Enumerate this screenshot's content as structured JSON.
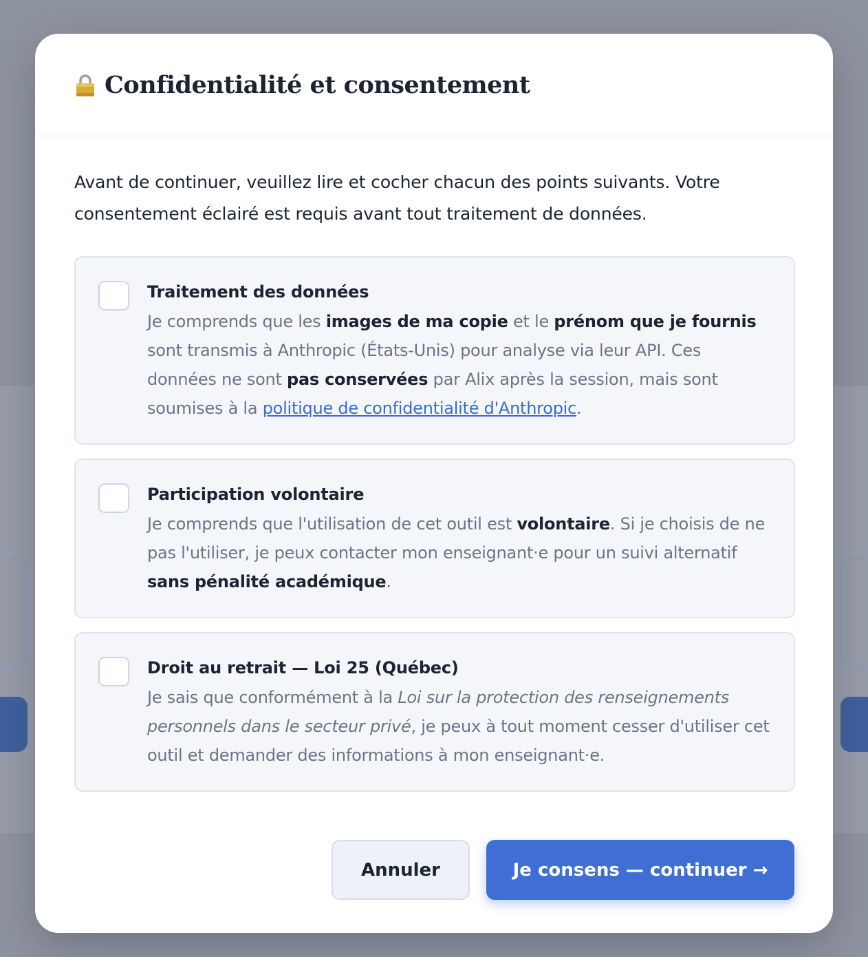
{
  "modal": {
    "title": "Confidentialité et consentement",
    "intro": "Avant de continuer, veuillez lire et cocher chacun des points suivants. Votre consentement éclairé est requis avant tout traitement de données."
  },
  "items": [
    {
      "title": "Traitement des données",
      "checked": false,
      "text": {
        "p1": "Je comprends que les ",
        "b1": "images de ma copie",
        "p2": " et le ",
        "b2": "prénom que je fournis",
        "p3": " sont transmis à Anthropic (États-Unis) pour analyse via leur API. Ces données ne sont ",
        "b3": "pas conservées",
        "p4": " par Alix après la session, mais sont soumises à la ",
        "link": "politique de confidentialité d'Anthropic",
        "p5": "."
      }
    },
    {
      "title": "Participation volontaire",
      "checked": false,
      "text": {
        "p1": "Je comprends que l'utilisation de cet outil est ",
        "b1": "volontaire",
        "p2": ". Si je choisis de ne pas l'utiliser, je peux contacter mon enseignant·e pour un suivi alternatif ",
        "b2": "sans pénalité académique",
        "p3": "."
      }
    },
    {
      "title": "Droit au retrait — Loi 25 (Québec)",
      "checked": false,
      "text": {
        "p1": "Je sais que conformément à la ",
        "i1": "Loi sur la protection des renseignements personnels dans le secteur privé",
        "p2": ", je peux à tout moment cesser d'utiliser cet outil et demander des informations à mon enseignant·e."
      }
    }
  ],
  "footer": {
    "cancel_label": "Annuler",
    "confirm_label": "Je consens — continuer →"
  },
  "colors": {
    "accent": "#3f6fd5",
    "overlay": "#9298a3",
    "link": "#3b6bd5"
  },
  "icons": {
    "title_icon": "lock-icon"
  }
}
